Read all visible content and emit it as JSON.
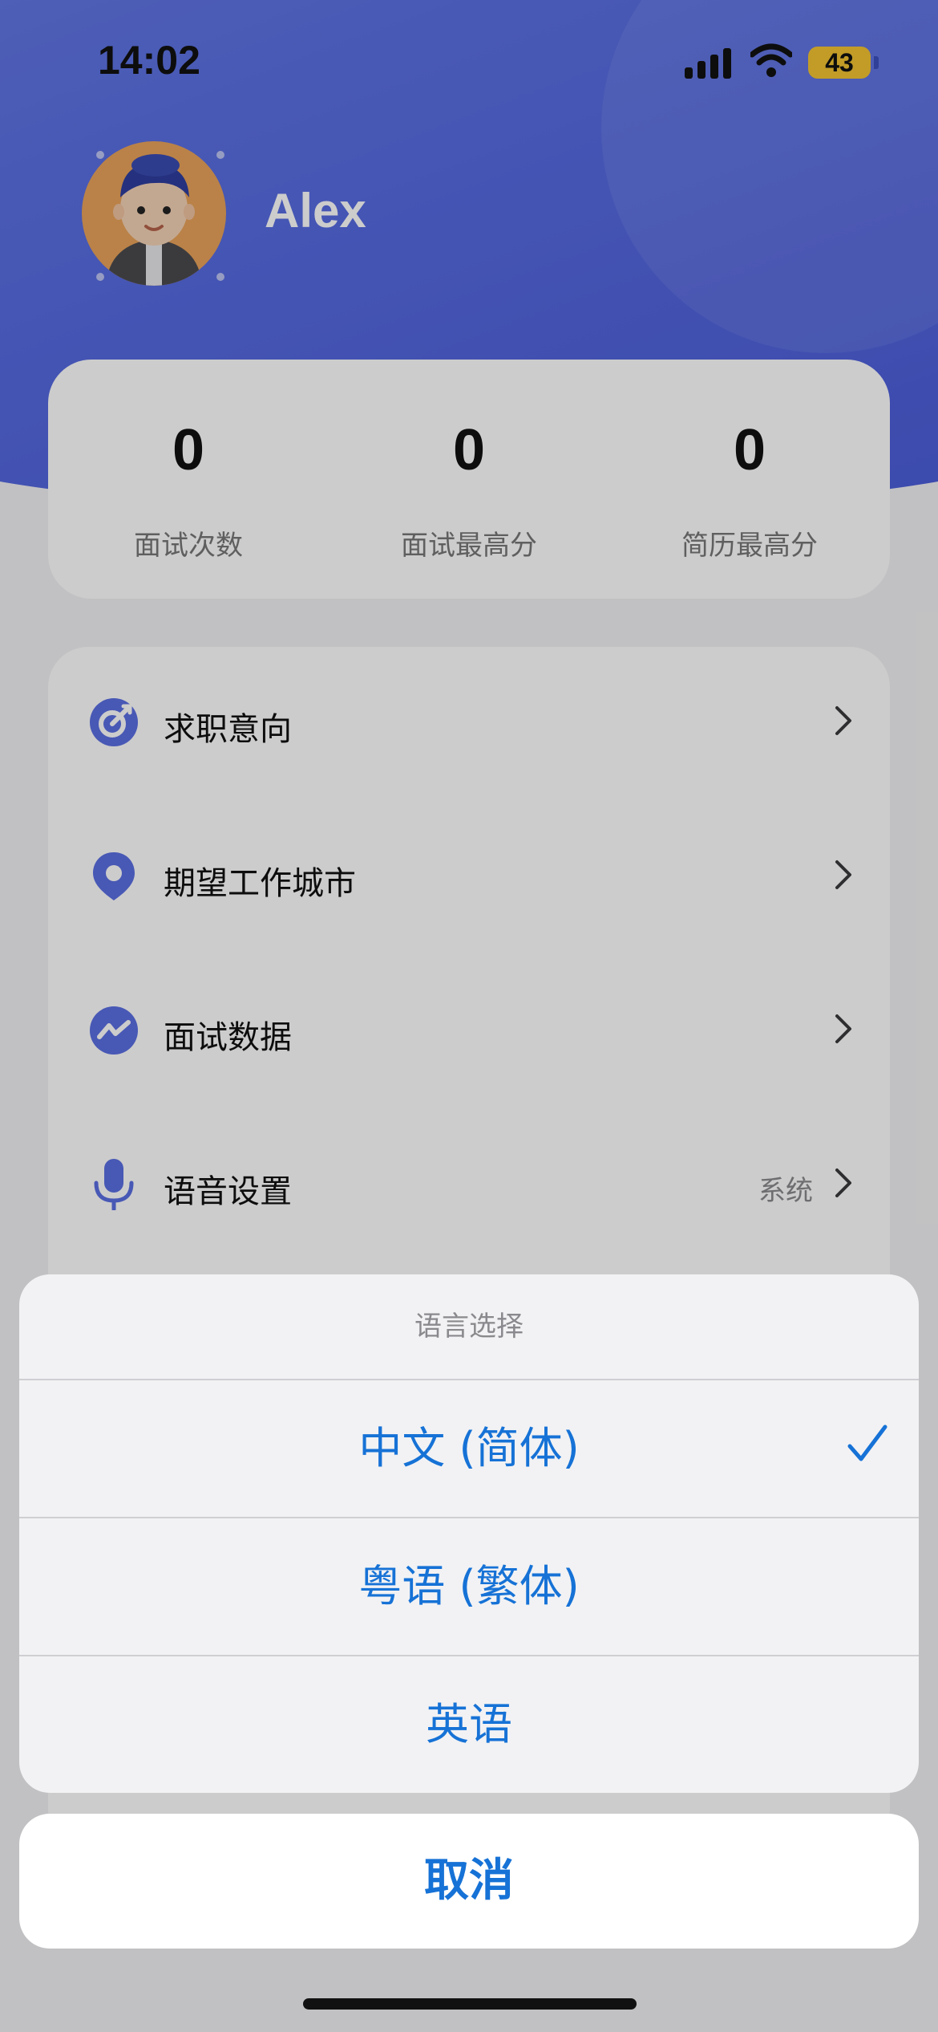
{
  "status_bar": {
    "time": "14:02",
    "battery": "43"
  },
  "profile": {
    "name": "Alex"
  },
  "stats": [
    {
      "value": "0",
      "label": "面试次数"
    },
    {
      "value": "0",
      "label": "面试最高分"
    },
    {
      "value": "0",
      "label": "简历最高分"
    }
  ],
  "menu": {
    "items": [
      {
        "label": "求职意向",
        "icon": "target-icon"
      },
      {
        "label": "期望工作城市",
        "icon": "location-pin-icon"
      },
      {
        "label": "面试数据",
        "icon": "trend-chart-icon"
      },
      {
        "label": "语音设置",
        "icon": "microphone-icon",
        "value": "系统"
      }
    ]
  },
  "language_sheet": {
    "title": "语言选择",
    "options": [
      {
        "label": "中文 (简体)",
        "selected": true
      },
      {
        "label": "粤语 (繁体)",
        "selected": false
      },
      {
        "label": "英语",
        "selected": false
      }
    ],
    "cancel": "取消"
  },
  "colors": {
    "accent": "#5a6fe3",
    "action_blue": "#1672d6",
    "battery": "#f3c431"
  }
}
